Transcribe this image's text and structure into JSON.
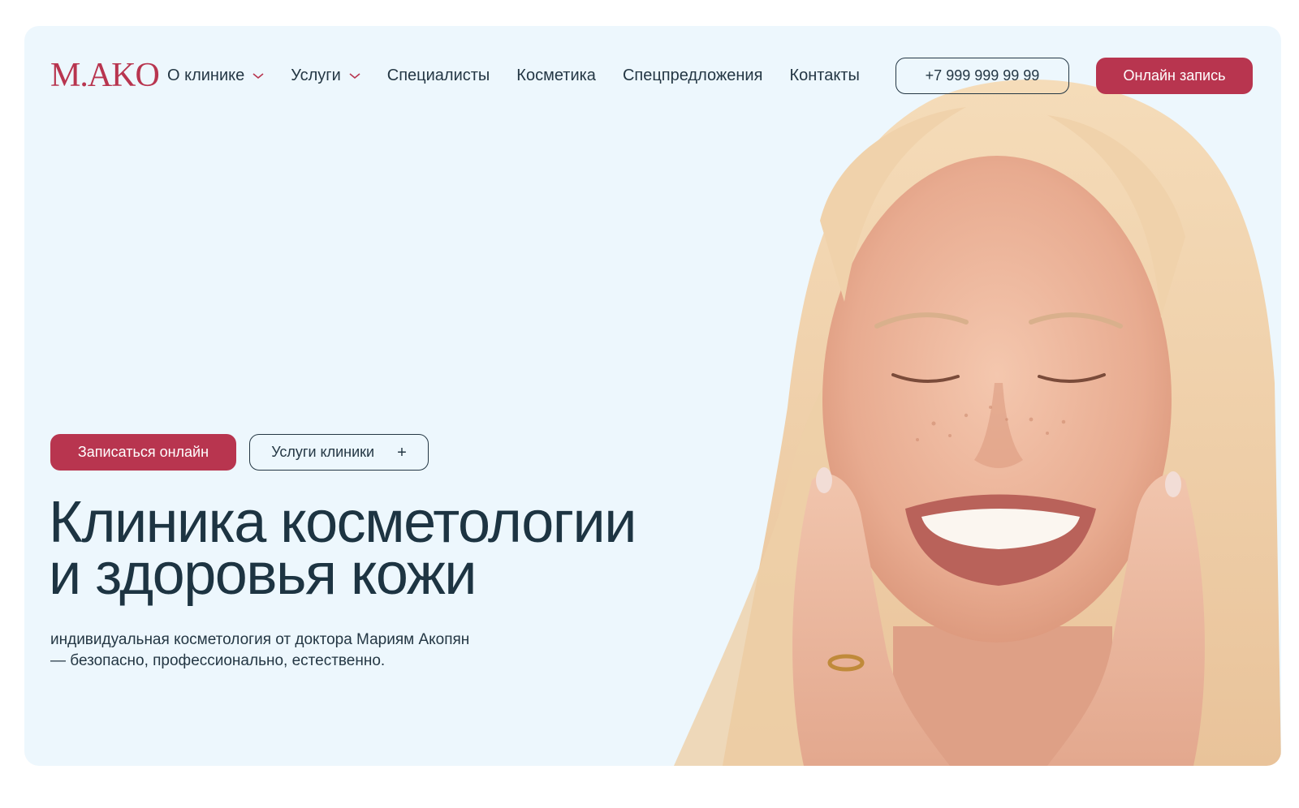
{
  "header": {
    "logo": "M.AKO",
    "nav": [
      {
        "label": "О клинике",
        "has_dropdown": true,
        "icon": "chevron-down-icon"
      },
      {
        "label": "Услуги",
        "has_dropdown": true,
        "icon": "chevron-down-icon"
      },
      {
        "label": "Специалисты",
        "has_dropdown": false
      },
      {
        "label": "Косметика",
        "has_dropdown": false
      },
      {
        "label": "Спецпредложения",
        "has_dropdown": false
      },
      {
        "label": "Контакты",
        "has_dropdown": false
      }
    ],
    "phone": "+7 999 999 99 99",
    "online_booking": "Онлайн запись"
  },
  "hero": {
    "cta_primary": "Записаться онлайн",
    "cta_secondary": "Услуги клиники",
    "cta_secondary_icon": "plus-icon",
    "title_line1": "Клиника косметологии",
    "title_line2": "и здоровья кожи",
    "subtitle_line1": "индивидуальная косметология от доктора Мариям Акопян",
    "subtitle_line2": "— безопасно, профессионально, естественно.",
    "image": "smiling-woman-photo"
  },
  "colors": {
    "accent": "#b8354f",
    "text": "#243744",
    "background": "#edf7fd"
  }
}
